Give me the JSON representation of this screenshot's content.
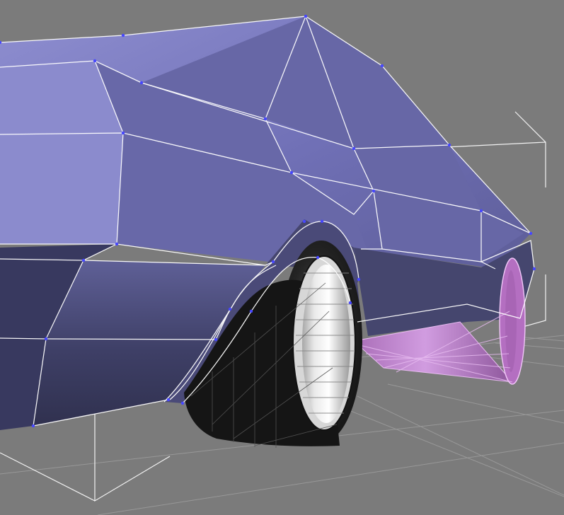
{
  "viewport": {
    "background_color": "#7b7b7b",
    "grid_color": "#989898",
    "grid_dark_color": "#111111"
  },
  "scene": {
    "car_body": {
      "color": "#6e6eb0",
      "highlight_color": "#8e8ed0",
      "shadow_color": "#3b3c67",
      "edge_color": "#ffffff",
      "vertex_color": "#4747ff"
    },
    "wheel": {
      "tire_color": "#222222",
      "rim_color": "#d9d9d9"
    },
    "exhaust": {
      "color": "#c58bd5",
      "edge_color": "#e7bbf0"
    },
    "selection_bounds": {
      "color": "#f2f2f2"
    }
  }
}
